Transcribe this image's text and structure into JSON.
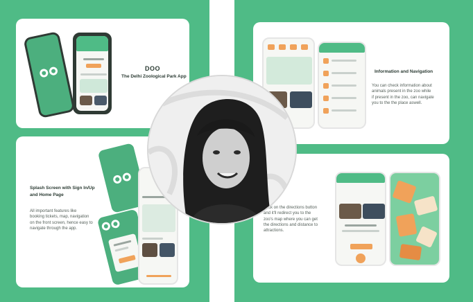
{
  "top_left": {
    "app_name": "DOO",
    "app_subtitle": "The Delhi Zoological Park App"
  },
  "bottom_left": {
    "title_line1": "Splash Screen with Sign In/Up",
    "title_line2": "and Home Page",
    "body_lines": [
      "All important features like",
      "booking tickets, map, navigation",
      "on the front screen, hence easy to",
      "navigate through the app."
    ]
  },
  "top_right": {
    "title": "Information and Navigation",
    "body_lines": [
      "You can check information about",
      "animals present in the zoo while",
      "if present in the zoo, can navigate",
      "you to the the place aswell."
    ]
  },
  "bottom_right": {
    "body_lines": [
      "Click on the directions button",
      "and it'll redirect you to the",
      "zoo's map where you can get",
      "the directions and distance to",
      "attractions."
    ]
  },
  "colors": {
    "brand_green": "#4fbb86",
    "accent_orange": "#f0a25a",
    "text_dark": "#2b3b33"
  }
}
